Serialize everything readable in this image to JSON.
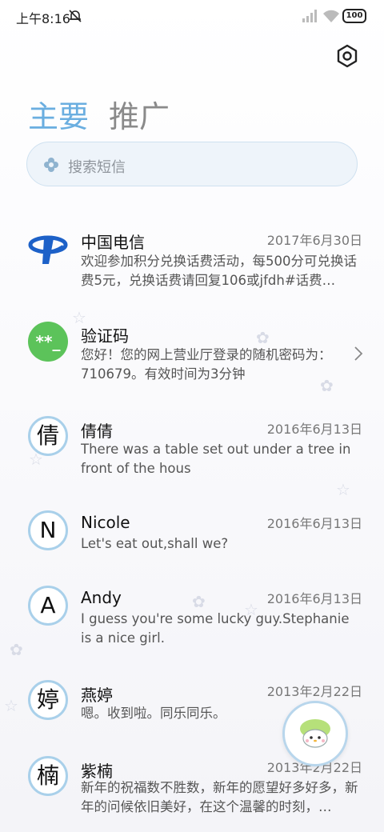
{
  "status_bar": {
    "time": "上午8:16",
    "battery": "100",
    "icons": [
      "mute-bell-icon",
      "signal-icon",
      "wifi-icon",
      "battery-icon"
    ]
  },
  "header": {
    "tabs": [
      {
        "label": "主要",
        "active": true
      },
      {
        "label": "推广",
        "active": false
      }
    ],
    "settings_icon": "settings-hexagon-icon"
  },
  "search": {
    "placeholder": "搜索短信",
    "icon": "flower-search-icon"
  },
  "colors": {
    "accent": "#6aaee0",
    "avatar_border": "#a9d0ea",
    "telecom_blue": "#1d61c8",
    "code_green": "#5cc35a"
  },
  "conversations": [
    {
      "name": "中国电信",
      "date": "2017年6月30日",
      "snippet": "欢迎参加积分兑换话费活动，每500分可兑换话费5元，兑换话费请回复106或jfdh#话费…",
      "avatar": "china-telecom-logo"
    },
    {
      "name": "验证码",
      "date": "",
      "snippet": "您好！您的网上营业厅登录的随机密码为：710679。有效时间为3分钟",
      "avatar": "**_"
    },
    {
      "name": "倩倩",
      "date": "2016年6月13日",
      "snippet": "There was a table set out under a tree in front of the hous",
      "avatar": "倩"
    },
    {
      "name": "Nicole",
      "date": "2016年6月13日",
      "snippet": "Let's eat out,shall we?",
      "avatar": "N"
    },
    {
      "name": "Andy",
      "date": "2016年6月13日",
      "snippet": "I guess you're some lucky guy.Stephanie is a nice girl.",
      "avatar": "A"
    },
    {
      "name": "燕婷",
      "date": "2013年2月22日",
      "snippet": "嗯。收到啦。同乐同乐。",
      "avatar": "婷"
    },
    {
      "name": "紫楠",
      "date": "2013年2月22日",
      "snippet": "新年的祝福数不胜数，新年的愿望好多好多，新年的问候依旧美好，在这个温馨的时刻，…",
      "avatar": "楠"
    }
  ],
  "fab_icon": "compose-cartoon-icon"
}
